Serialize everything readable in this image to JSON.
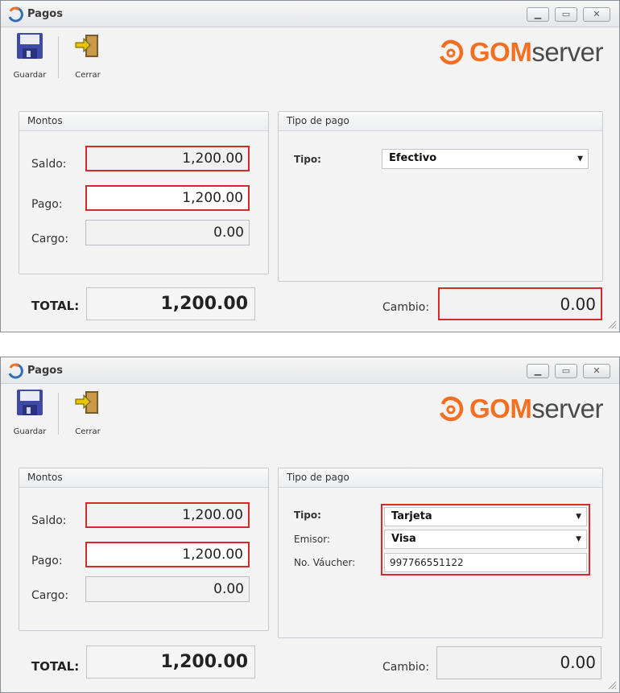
{
  "windows": [
    {
      "title": "Pagos",
      "toolbar": {
        "save_label": "Guardar",
        "close_label": "Cerrar"
      },
      "brand": {
        "gom": "GOM",
        "server": "server"
      },
      "montos": {
        "header": "Montos",
        "saldo_label": "Saldo:",
        "saldo_value": "1,200.00",
        "pago_label": "Pago:",
        "pago_value": "1,200.00",
        "cargo_label": "Cargo:",
        "cargo_value": "0.00"
      },
      "tipo_pago": {
        "header": "Tipo de pago",
        "tipo_label": "Tipo:",
        "tipo_value": "Efectivo"
      },
      "total": {
        "label": "TOTAL:",
        "value": "1,200.00"
      },
      "cambio": {
        "label": "Cambio:",
        "value": "0.00"
      }
    },
    {
      "title": "Pagos",
      "toolbar": {
        "save_label": "Guardar",
        "close_label": "Cerrar"
      },
      "brand": {
        "gom": "GOM",
        "server": "server"
      },
      "montos": {
        "header": "Montos",
        "saldo_label": "Saldo:",
        "saldo_value": "1,200.00",
        "pago_label": "Pago:",
        "pago_value": "1,200.00",
        "cargo_label": "Cargo:",
        "cargo_value": "0.00"
      },
      "tipo_pago": {
        "header": "Tipo de pago",
        "tipo_label": "Tipo:",
        "tipo_value": "Tarjeta",
        "emisor_label": "Emisor:",
        "emisor_value": "Visa",
        "voucher_label": "No. Váucher:",
        "voucher_value": "997766551122"
      },
      "total": {
        "label": "TOTAL:",
        "value": "1,200.00"
      },
      "cambio": {
        "label": "Cambio:",
        "value": "0.00"
      }
    }
  ],
  "colors": {
    "highlight": "#d32b2b",
    "brand_orange": "#f36f21",
    "brand_gray": "#4b4b4b",
    "logo_blue": "#2f6db5"
  },
  "icons": [
    "app-logo-icon",
    "save-floppy-icon",
    "exit-door-icon",
    "minimize-icon",
    "maximize-icon",
    "close-icon"
  ]
}
